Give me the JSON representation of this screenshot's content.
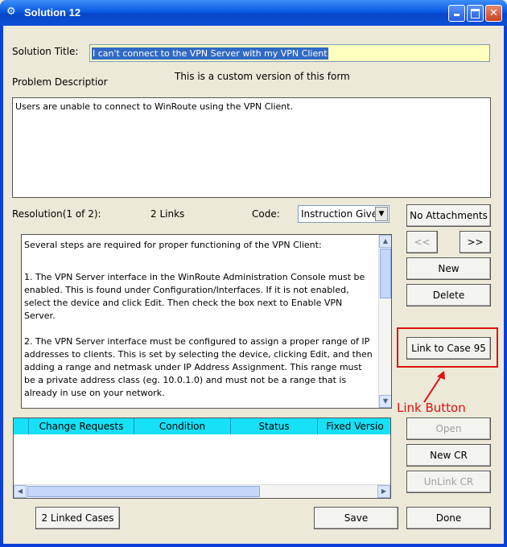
{
  "window": {
    "title": "Solution 12",
    "controls": [
      "minimize",
      "maximize",
      "close"
    ]
  },
  "form": {
    "solution_title_label": "Solution Title:",
    "solution_title_value": "I can't connect to the VPN Server with my VPN Client",
    "custom_note": "This is a custom version of this form",
    "problem_label": "Problem Descriptior",
    "problem_text": "Users are unable to connect to WinRoute using the VPN Client.",
    "resolution_label": "Resolution(1 of 2):",
    "links_text": "2 Links",
    "code_label": "Code:",
    "code_value": "Instruction Give",
    "resolution_paragraphs": [
      "Several steps are required for proper functioning of the VPN Client:",
      "1. The VPN Server interface in the WinRoute Administration Console must be enabled. This is found under Configuration/Interfaces. If it is not enabled, select the device and click Edit. Then check the box next to Enable VPN Server.",
      "2. The VPN Server interface must be configured to assign a proper range of IP addresses to clients. This is set by selecting the device, clicking Edit, and then adding a range and netmask under IP Address Assignment. This range must be a private address class (eg. 10.0.1.0) and must not be a range that is already in use on your network."
    ]
  },
  "grid": {
    "columns": [
      "Change Requests",
      "Condition",
      "Status",
      "Fixed Versio"
    ]
  },
  "buttons": {
    "no_attachments": "No Attachments",
    "prev": "<<",
    "next": ">>",
    "new": "New",
    "delete": "Delete",
    "link_to_case": "Link to Case 95",
    "open": "Open",
    "new_cr": "New CR",
    "unlink_cr": "UnLink CR",
    "linked_cases": "2 Linked Cases",
    "save": "Save",
    "done": "Done"
  },
  "annotation": {
    "label": "Link Button",
    "color": "#e01010"
  }
}
